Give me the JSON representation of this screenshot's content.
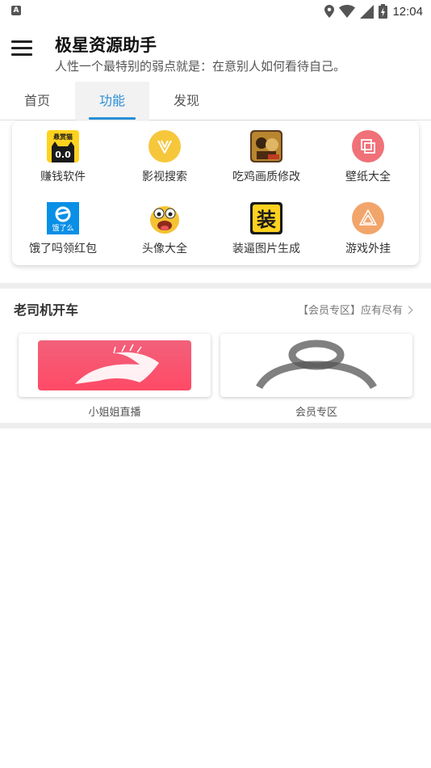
{
  "status_bar": {
    "notification_icon": "A",
    "time": "12:04",
    "icons": [
      "location-icon",
      "wifi-icon",
      "signal-icon",
      "battery-icon"
    ]
  },
  "header": {
    "title": "极星资源助手",
    "subtitle": "人性一个最特别的弱点就是：在意别人如何看待自己。",
    "menu_icon": "hamburger-icon"
  },
  "tabs": [
    {
      "label": "首页",
      "active": false
    },
    {
      "label": "功能",
      "active": true
    },
    {
      "label": "发现",
      "active": false
    }
  ],
  "features": [
    {
      "label": "赚钱软件",
      "icon": "cat-icon"
    },
    {
      "label": "影视搜索",
      "icon": "v-logo-icon"
    },
    {
      "label": "吃鸡画质修改",
      "icon": "pubg-icon"
    },
    {
      "label": "壁纸大全",
      "icon": "wallpaper-icon"
    },
    {
      "label": "饿了吗领红包",
      "icon": "eleme-icon"
    },
    {
      "label": "头像大全",
      "icon": "emoji-face-icon"
    },
    {
      "label": "装逼图片生成",
      "icon": "zhuang-icon"
    },
    {
      "label": "游戏外挂",
      "icon": "triangle-icon"
    }
  ],
  "feature_icon_text": {
    "cat_top": "悬赏猫",
    "cat_bottom": "0.0",
    "eleme": "饿了么",
    "zhuang": "装"
  },
  "section": {
    "title": "老司机开车",
    "more_label": "【会员专区】应有尽有",
    "tiles": [
      {
        "label": "小姐姐直播",
        "image": "girl-silhouette-banner"
      },
      {
        "label": "会员专区",
        "image": "user-silhouette"
      }
    ]
  },
  "colors": {
    "accent": "#2a8fd6",
    "banner_start": "#f2607a",
    "banner_end": "#ff4a66"
  }
}
